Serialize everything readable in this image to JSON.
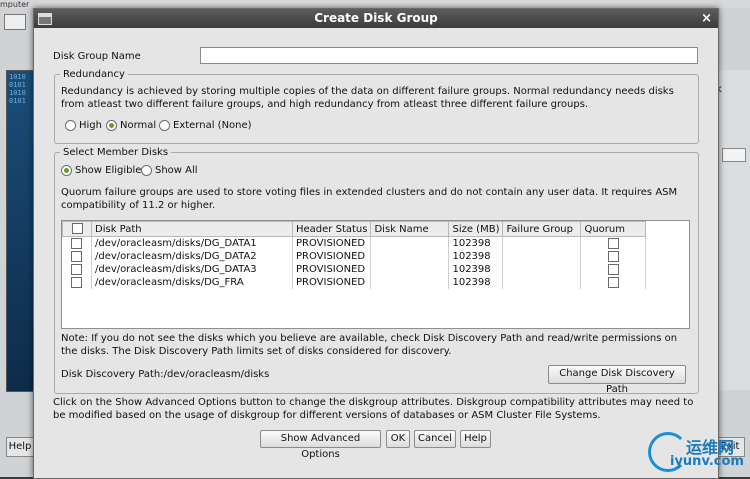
{
  "background": {
    "left_title": "mputer",
    "binary_text": "1010\n0101\n1010\n0101",
    "left_help": "Help",
    "right_letter": "k",
    "right_edit": "Exit"
  },
  "dialog": {
    "title": "Create Disk Group",
    "close_glyph": "×",
    "disk_group_name_label": "Disk Group Name",
    "disk_group_name_value": ""
  },
  "redundancy": {
    "legend": "Redundancy",
    "description": "Redundancy is achieved by storing multiple copies of the data on different failure groups. Normal redundancy needs disks from atleast two different failure groups, and high redundancy from atleast three different failure groups.",
    "options": [
      {
        "label": "High",
        "selected": false
      },
      {
        "label": "Normal",
        "selected": true
      },
      {
        "label": "External (None)",
        "selected": false
      }
    ]
  },
  "member_disks": {
    "legend": "Select Member Disks",
    "filter_options": [
      {
        "label": "Show Eligible",
        "selected": true
      },
      {
        "label": "Show All",
        "selected": false
      }
    ],
    "quorum_note": "Quorum failure groups are used to store voting files in extended clusters and do not contain any user data. It requires ASM compatibility of 11.2 or higher.",
    "columns": [
      "Disk Path",
      "Header Status",
      "Disk Name",
      "Size (MB)",
      "Failure Group",
      "Quorum"
    ],
    "rows": [
      {
        "path": "/dev/oracleasm/disks/DG_DATA1",
        "status": "PROVISIONED",
        "name": "",
        "size": "102398",
        "failure_group": ""
      },
      {
        "path": "/dev/oracleasm/disks/DG_DATA2",
        "status": "PROVISIONED",
        "name": "",
        "size": "102398",
        "failure_group": ""
      },
      {
        "path": "/dev/oracleasm/disks/DG_DATA3",
        "status": "PROVISIONED",
        "name": "",
        "size": "102398",
        "failure_group": ""
      },
      {
        "path": "/dev/oracleasm/disks/DG_FRA",
        "status": "PROVISIONED",
        "name": "",
        "size": "102398",
        "failure_group": ""
      }
    ],
    "discovery_note": "Note: If you do not see the disks which you believe are available, check Disk Discovery Path and read/write permissions on the disks. The Disk Discovery Path limits set of disks considered for discovery.",
    "discovery_path": "Disk Discovery Path:/dev/oracleasm/disks",
    "change_path_button": "Change Disk Discovery Path"
  },
  "footer": {
    "advanced_note": "Click on the Show Advanced Options button to change the diskgroup attributes. Diskgroup compatibility attributes may need to be modified based on the usage of diskgroup for different versions of databases or ASM Cluster File Systems.",
    "buttons": {
      "advanced": "Show Advanced Options",
      "ok": "OK",
      "cancel": "Cancel",
      "help": "Help"
    }
  },
  "watermark": {
    "cn": "运维网",
    "en": "iyunv.com"
  }
}
